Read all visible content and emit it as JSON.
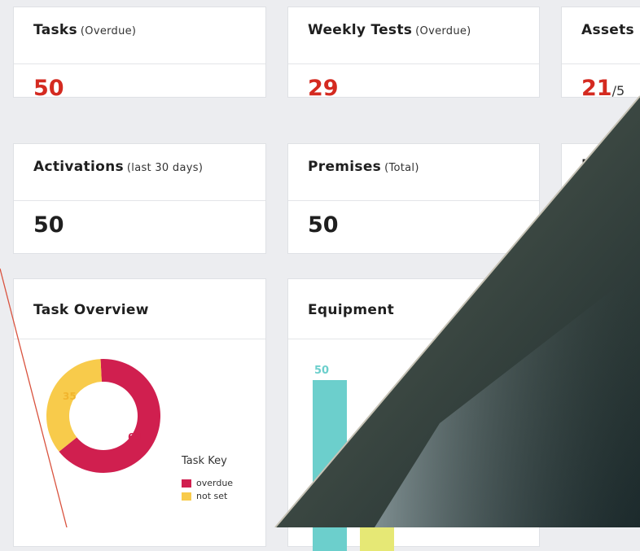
{
  "cards": {
    "tasks": {
      "title": "Tasks",
      "subtitle": "(Overdue)",
      "value": "50"
    },
    "weekly_tests": {
      "title": "Weekly Tests",
      "subtitle": "(Overdue)",
      "value": "29"
    },
    "assets": {
      "title": "Assets",
      "value": "21",
      "suffix": "/5"
    },
    "activations": {
      "title": "Activations",
      "subtitle": "(last 30 days)",
      "value": "50"
    },
    "premises": {
      "title": "Premises",
      "subtitle": "(Total)",
      "value": "50"
    },
    "last": {
      "title": "Last"
    }
  },
  "task_overview": {
    "title": "Task Overview",
    "legend_title": "Task Key",
    "legend": [
      {
        "label": "overdue",
        "color": "#d01f4f"
      },
      {
        "label": "not set",
        "color": "#f8cb4b"
      }
    ]
  },
  "equipment": {
    "title": "Equipment"
  },
  "chart_data": [
    {
      "type": "pie",
      "title": "Task Overview",
      "categories": [
        "overdue",
        "not set"
      ],
      "values": [
        65,
        35
      ],
      "colors": [
        "#d01f4f",
        "#f8cb4b"
      ]
    },
    {
      "type": "bar",
      "title": "Equipment",
      "categories": [
        "",
        ""
      ],
      "values": [
        50,
        32
      ],
      "colors": [
        "#6ccfcc",
        "#e6e875"
      ]
    }
  ]
}
